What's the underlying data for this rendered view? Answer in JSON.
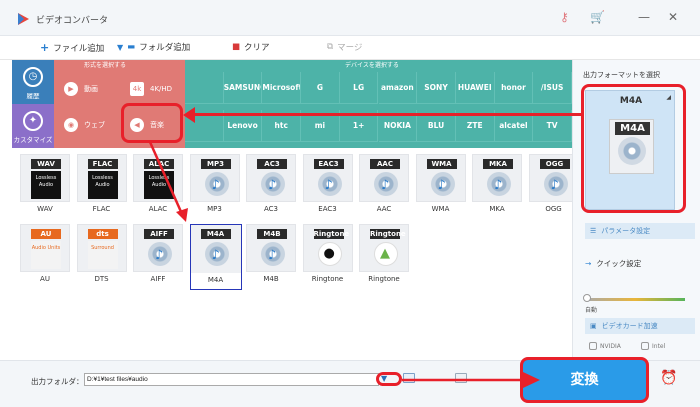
{
  "app": {
    "title": "ビデオコンバータ",
    "title_icons": [
      "key-icon",
      "cart-icon"
    ],
    "window_controls": [
      "minimize-icon",
      "close-icon"
    ]
  },
  "toolbar": {
    "add_file": "ファイル追加",
    "add_folder": "フォルダ追加",
    "clear": "クリア",
    "merge": "マージ"
  },
  "nav": {
    "history": "履歴",
    "customize": "カスタマイズ"
  },
  "format_section": {
    "header": "形式を選択する",
    "video": "動画",
    "hd": "4K/HD",
    "web": "ウェブ",
    "audio": "音楽"
  },
  "device_section": {
    "header": "デバイスを選択する",
    "brands": [
      "",
      "SAMSUNG",
      "Microsoft",
      "G",
      "LG",
      "amazon",
      "SONY",
      "HUAWEI",
      "honor",
      "/ISUS",
      "",
      "Lenovo",
      "htc",
      "mi",
      "1+",
      "NOKIA",
      "BLU",
      "ZTE",
      "alcatel",
      "TV"
    ]
  },
  "formats_row1": [
    {
      "tag": "WAV",
      "label": "WAV",
      "kind": "lossless"
    },
    {
      "tag": "FLAC",
      "label": "FLAC",
      "kind": "lossless"
    },
    {
      "tag": "ALAC",
      "label": "ALAC",
      "kind": "lossless"
    },
    {
      "tag": "MP3",
      "label": "MP3",
      "kind": "disc"
    },
    {
      "tag": "AC3",
      "label": "AC3",
      "kind": "disc"
    },
    {
      "tag": "EAC3",
      "label": "EAC3",
      "kind": "disc"
    },
    {
      "tag": "AAC",
      "label": "AAC",
      "kind": "disc"
    },
    {
      "tag": "WMA",
      "label": "WMA",
      "kind": "disc"
    },
    {
      "tag": "MKA",
      "label": "MKA",
      "kind": "disc"
    },
    {
      "tag": "OGG",
      "label": "OGG",
      "kind": "disc"
    }
  ],
  "formats_row2": [
    {
      "tag": "AU",
      "label": "AU",
      "kind": "au"
    },
    {
      "tag": "dts",
      "label": "DTS",
      "kind": "dts"
    },
    {
      "tag": "AIFF",
      "label": "AIFF",
      "kind": "disc"
    },
    {
      "tag": "M4A",
      "label": "M4A",
      "kind": "disc",
      "selected": true
    },
    {
      "tag": "M4B",
      "label": "M4B",
      "kind": "disc"
    },
    {
      "tag": "Ringtone",
      "label": "Ringtone",
      "kind": "apple"
    },
    {
      "tag": "Ringtone",
      "label": "Ringtone",
      "kind": "android"
    }
  ],
  "lossless_text": "Lossless Audio",
  "au_text": "Audio Units",
  "dts_text": "Surround",
  "right": {
    "title": "出力フォーマットを選択",
    "selected": "M4A",
    "selected_icon_tag": "M4A",
    "params": "パラメータ設定",
    "quick": "クイック設定",
    "auto": "自動",
    "gpu": "ビデオカード加速",
    "nvidia": "NVIDIA",
    "intel": "Intel"
  },
  "bottom": {
    "output_label": "出力フォルダ：",
    "output_path": "D:¥1¥test files¥audio",
    "convert": "変換"
  },
  "colors": {
    "accent": "#2a9be8",
    "format_bg": "#e07a75",
    "device_bg": "#4db3a8",
    "annotation": "#e8202a"
  }
}
